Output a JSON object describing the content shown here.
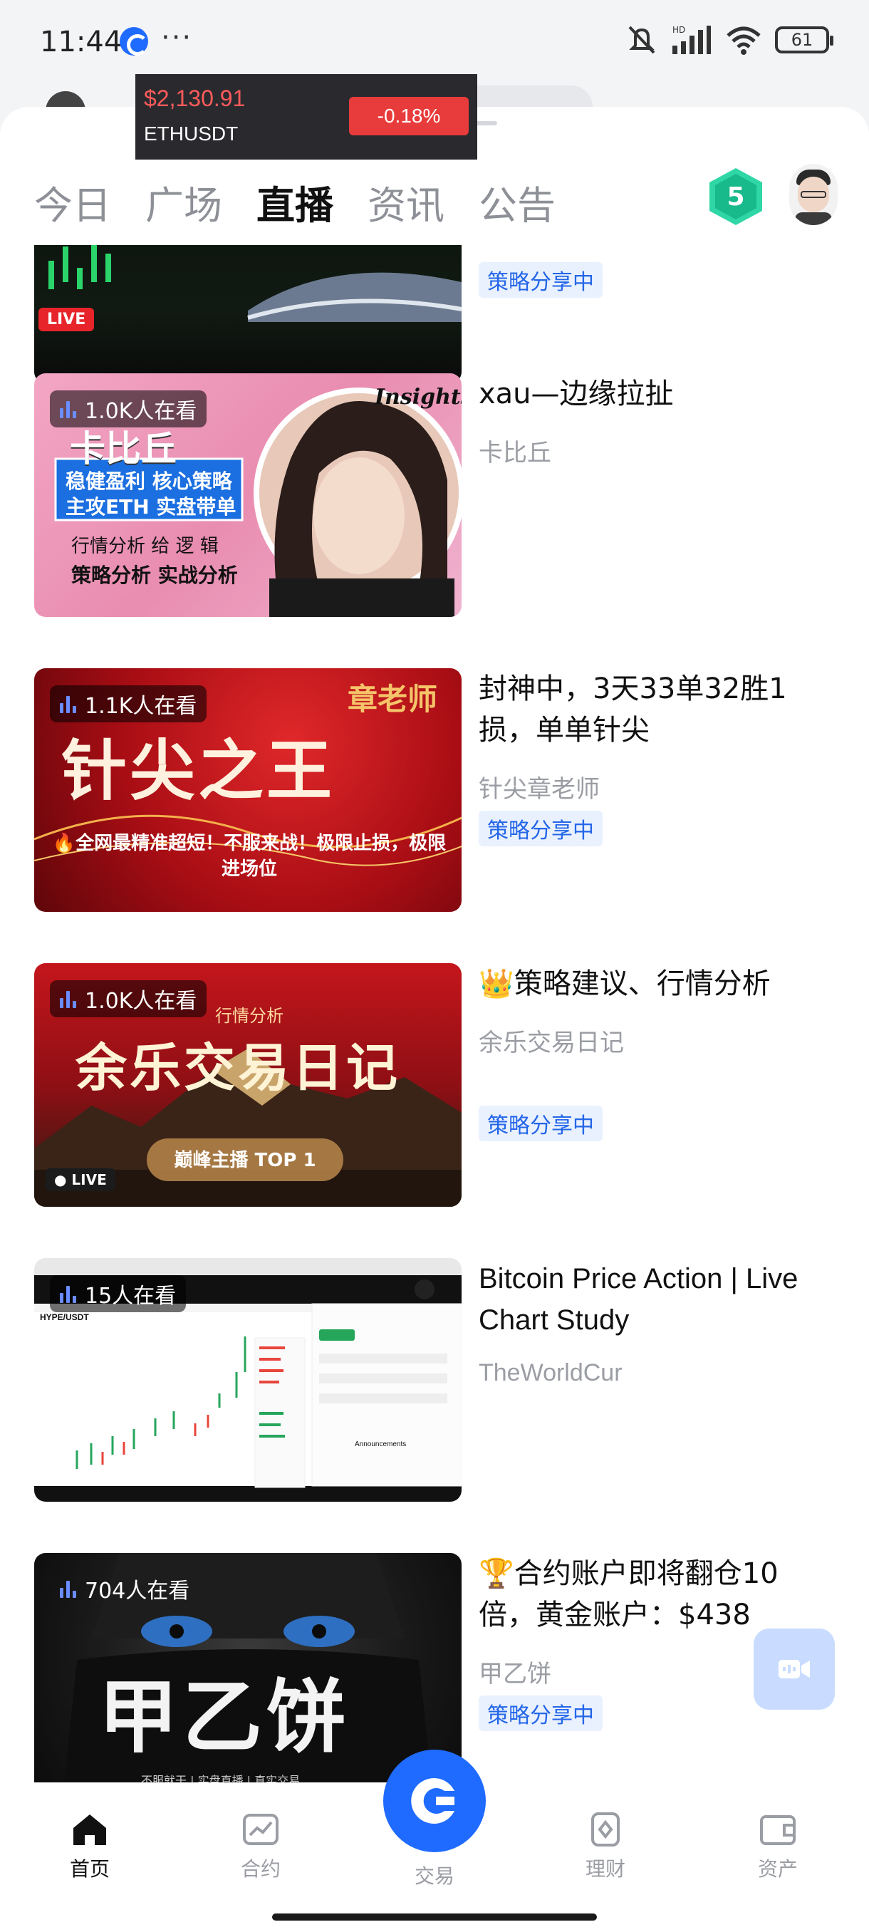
{
  "status_bar": {
    "time": "11:44",
    "dots": "···",
    "network": "HD",
    "battery": "61"
  },
  "ticker": {
    "price": "$2,130.91",
    "symbol": "ETHUSDT",
    "change": "-0.18%",
    "colors": {
      "price": "#ff5b5b",
      "change_bg": "#e83b3b"
    }
  },
  "tabs": [
    {
      "label": "今日",
      "active": false
    },
    {
      "label": "广场",
      "active": false
    },
    {
      "label": "直播",
      "active": true
    },
    {
      "label": "资讯",
      "active": false
    },
    {
      "label": "公告",
      "active": false
    }
  ],
  "level_badge": "5",
  "top_partial_card": {
    "live_label": "LIVE",
    "tag": "策略分享中"
  },
  "streams": [
    {
      "viewers": "1.0K人在看",
      "title": "xau—边缘拉扯",
      "author": "卡比丘",
      "tag": "",
      "thumb_text": {
        "name": "卡比丘",
        "line1": "稳健盈利  核心策略",
        "line2": "主攻ETH  实盘带单",
        "line3": "行情分析 给 逻 辑",
        "line4": "策略分析 实战分析",
        "corner": "Insights"
      }
    },
    {
      "viewers": "1.1K人在看",
      "title": "封神中，3天33单32胜1损，单单针尖",
      "author": "针尖章老师",
      "tag": "策略分享中",
      "thumb_text": {
        "name": "针尖之王",
        "corner": "章老师",
        "line1": "🔥全网最精准超短！不服来战！极限止损，极限进场位"
      }
    },
    {
      "viewers": "1.0K人在看",
      "title": "👑策略建议、行情分析",
      "author": "余乐交易日记",
      "tag": "策略分享中",
      "thumb_text": {
        "small": "行情分析",
        "name": "余乐交易日记",
        "pill": "巅峰主播 TOP 1",
        "live": "● LIVE"
      }
    },
    {
      "viewers": "15人在看",
      "title": "Bitcoin Price Action | Live Chart Study",
      "author": "TheWorldCur",
      "tag": "",
      "thumb_text": {
        "pair": "HYPE/USDT",
        "panel": "Announcements"
      }
    },
    {
      "viewers": "704人在看",
      "title": "🏆合约账户即将翻仓10倍，黄金账户：$438",
      "author": "甲乙饼",
      "tag": "策略分享中",
      "thumb_text": {
        "name": "甲乙饼",
        "sub": "不服就干 | 实盘直播 | 真实交易"
      }
    }
  ],
  "bottom_nav": [
    {
      "label": "首页",
      "icon": "home-icon",
      "active": true
    },
    {
      "label": "合约",
      "icon": "futures-chart-icon",
      "active": false
    },
    {
      "label": "交易",
      "icon": "trade-logo-icon",
      "active": false
    },
    {
      "label": "理财",
      "icon": "finance-icon",
      "active": false
    },
    {
      "label": "资产",
      "icon": "assets-wallet-icon",
      "active": false
    }
  ],
  "colors": {
    "accent": "#1f6bff",
    "tag_bg": "#e9f1ff",
    "tag_text": "#2466e8"
  }
}
